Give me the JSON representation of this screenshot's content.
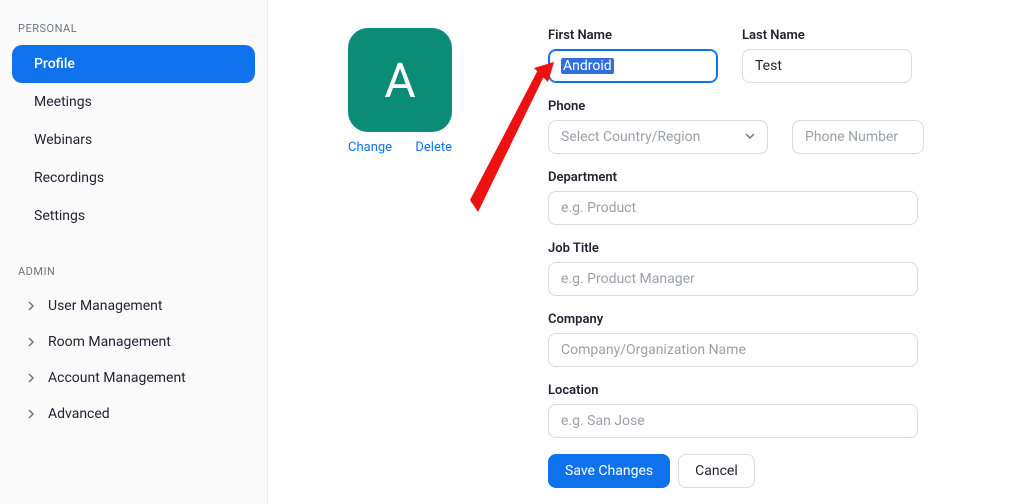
{
  "sidebar": {
    "personal_label": "PERSONAL",
    "admin_label": "ADMIN",
    "items": [
      {
        "label": "Profile"
      },
      {
        "label": "Meetings"
      },
      {
        "label": "Webinars"
      },
      {
        "label": "Recordings"
      },
      {
        "label": "Settings"
      }
    ],
    "admin_items": [
      {
        "label": "User Management"
      },
      {
        "label": "Room Management"
      },
      {
        "label": "Account Management"
      },
      {
        "label": "Advanced"
      }
    ]
  },
  "avatar": {
    "letter": "A",
    "change_label": "Change",
    "delete_label": "Delete",
    "bg_color": "#0b8c77"
  },
  "profile": {
    "first_name_label": "First Name",
    "first_name_value": "Android",
    "last_name_label": "Last Name",
    "last_name_value": "Test",
    "phone_label": "Phone",
    "phone_country_placeholder": "Select Country/Region",
    "phone_number_placeholder": "Phone Number",
    "department_label": "Department",
    "department_placeholder": "e.g. Product",
    "job_title_label": "Job Title",
    "job_title_placeholder": "e.g. Product Manager",
    "company_label": "Company",
    "company_placeholder": "Company/Organization Name",
    "location_label": "Location",
    "location_placeholder": "e.g. San Jose",
    "save_label": "Save Changes",
    "cancel_label": "Cancel"
  },
  "colors": {
    "accent": "#0e72ed"
  }
}
